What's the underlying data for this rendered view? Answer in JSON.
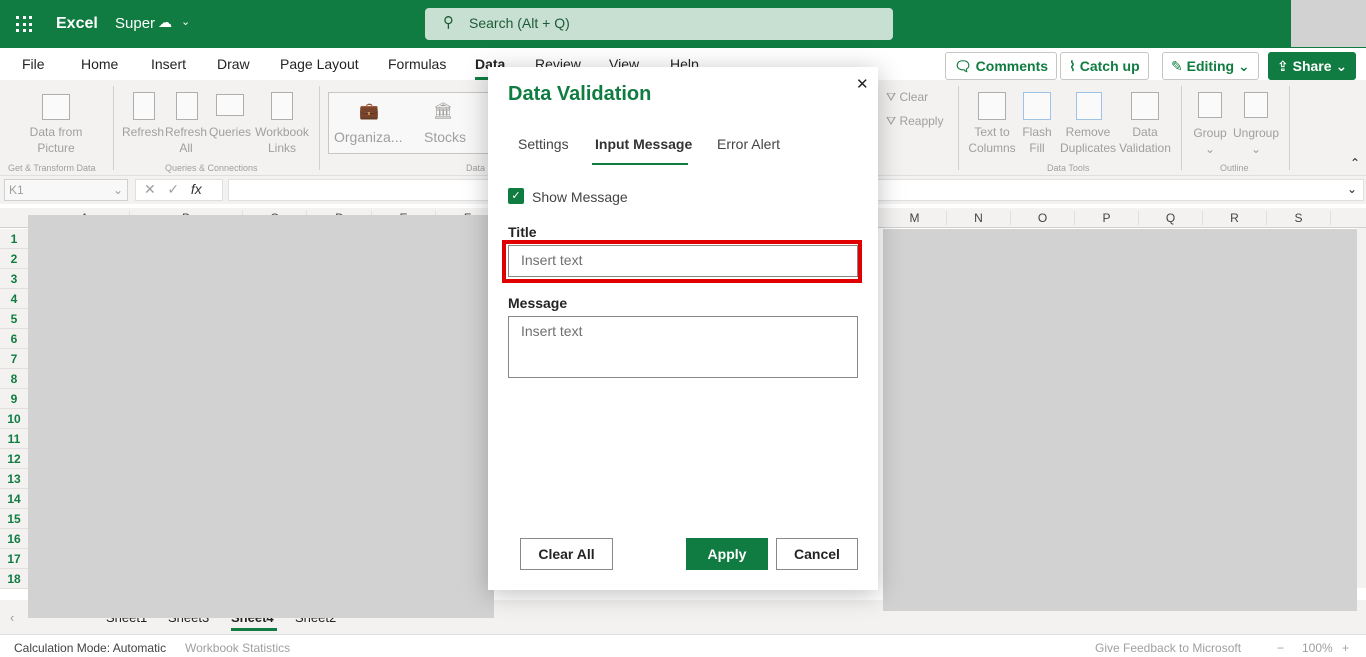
{
  "app": {
    "name": "Excel",
    "file_name": "Super",
    "search_placeholder": "Search (Alt + Q)"
  },
  "menu_tabs": [
    "File",
    "Home",
    "Insert",
    "Draw",
    "Page Layout",
    "Formulas",
    "Data",
    "Review",
    "View",
    "Help"
  ],
  "active_tab": "Data",
  "top_buttons": {
    "comments": "Comments",
    "catch_up": "Catch up",
    "editing": "Editing",
    "share": "Share"
  },
  "ribbon": {
    "data_from_picture": [
      "Data from",
      "Picture"
    ],
    "refresh": "Refresh",
    "refresh_all": [
      "Refresh",
      "All"
    ],
    "queries": "Queries",
    "workbook_links": [
      "Workbook",
      "Links"
    ],
    "organization": "Organiza...",
    "stocks": "Stocks",
    "clear": "Clear",
    "reapply": "Reapply",
    "text_to_columns": [
      "Text to",
      "Columns"
    ],
    "flash_fill": [
      "Flash",
      "Fill"
    ],
    "remove_duplicates": [
      "Remove",
      "Duplicates"
    ],
    "data_validation": [
      "Data",
      "Validation"
    ],
    "group": "Group",
    "ungroup": "Ungroup",
    "groups": {
      "get_transform": "Get & Transform Data",
      "queries_connections": "Queries & Connections",
      "data_types": "Data",
      "data_tools": "Data Tools",
      "outline": "Outline"
    }
  },
  "formula_bar": {
    "name_box": "K1",
    "fx": "fx",
    "value": ""
  },
  "columns_left": [
    "A",
    "B",
    "C",
    "D",
    "E",
    "F"
  ],
  "columns_right": [
    "M",
    "N",
    "O",
    "P",
    "Q",
    "R",
    "S"
  ],
  "rows": [
    "1",
    "2",
    "3",
    "4",
    "5",
    "6",
    "7",
    "8",
    "9",
    "10",
    "11",
    "12",
    "13",
    "14",
    "15",
    "16",
    "17",
    "18"
  ],
  "dialog": {
    "title": "Data Validation",
    "tabs": [
      "Settings",
      "Input Message",
      "Error Alert"
    ],
    "active_tab": "Input Message",
    "show_message_label": "Show Message",
    "show_message_checked": true,
    "title_label": "Title",
    "title_placeholder": "Insert text",
    "title_value": "",
    "message_label": "Message",
    "message_placeholder": "Insert text",
    "message_value": "",
    "clear_all": "Clear All",
    "apply": "Apply",
    "cancel": "Cancel"
  },
  "sheets": [
    "Sheet1",
    "Sheet3",
    "Sheet4",
    "Sheet2"
  ],
  "active_sheet": "Sheet4",
  "status": {
    "calc_mode": "Calculation Mode: Automatic",
    "workbook_stats": "Workbook Statistics",
    "feedback": "Give Feedback to Microsoft",
    "zoom": "100%"
  },
  "colors": {
    "brand": "#107c41",
    "highlight": "#e00000"
  }
}
